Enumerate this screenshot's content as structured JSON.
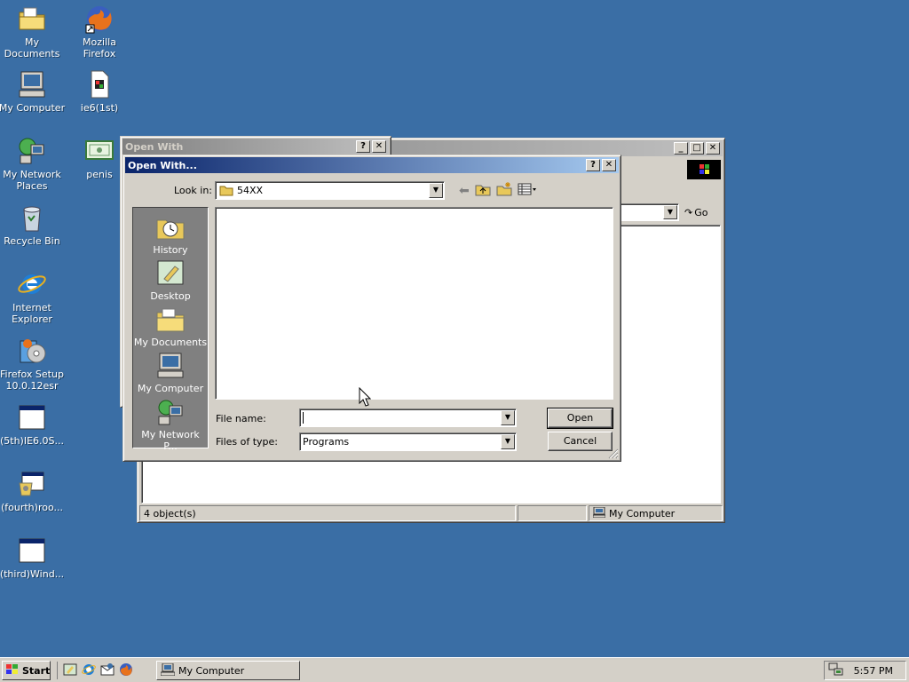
{
  "desktop": {
    "icons": [
      {
        "label": "My Documents"
      },
      {
        "label": "Mozilla Firefox"
      },
      {
        "label": "My Computer"
      },
      {
        "label": "ie6(1st)"
      },
      {
        "label": "My Network Places"
      },
      {
        "label": "penis"
      },
      {
        "label": "Recycle Bin"
      },
      {
        "label": "Internet Explorer"
      },
      {
        "label": "Firefox Setup 10.0.12esr"
      },
      {
        "label": "(5th)IE6.0S..."
      },
      {
        "label": "(fourth)roo..."
      },
      {
        "label": "(third)Wind..."
      }
    ]
  },
  "bg_window": {
    "status_left": "4 object(s)",
    "status_right": "My Computer",
    "go_label": "Go"
  },
  "open_with_parent": {
    "title": "Open With"
  },
  "dialog": {
    "title": "Open With...",
    "look_in_label": "Look in:",
    "look_in_value": "54XX",
    "places": [
      {
        "label": "History"
      },
      {
        "label": "Desktop"
      },
      {
        "label": "My Documents"
      },
      {
        "label": "My Computer"
      },
      {
        "label": "My Network P..."
      }
    ],
    "file_name_label": "File name:",
    "file_name_value": "",
    "files_of_type_label": "Files of type:",
    "files_of_type_value": "Programs",
    "open_label": "Open",
    "cancel_label": "Cancel"
  },
  "taskbar": {
    "start_label": "Start",
    "task_label": "My Computer",
    "clock": "5:57 PM"
  },
  "colors": {
    "desktop": "#3a6ea5",
    "title_active": "#0a246a",
    "face": "#d4d0c8"
  }
}
